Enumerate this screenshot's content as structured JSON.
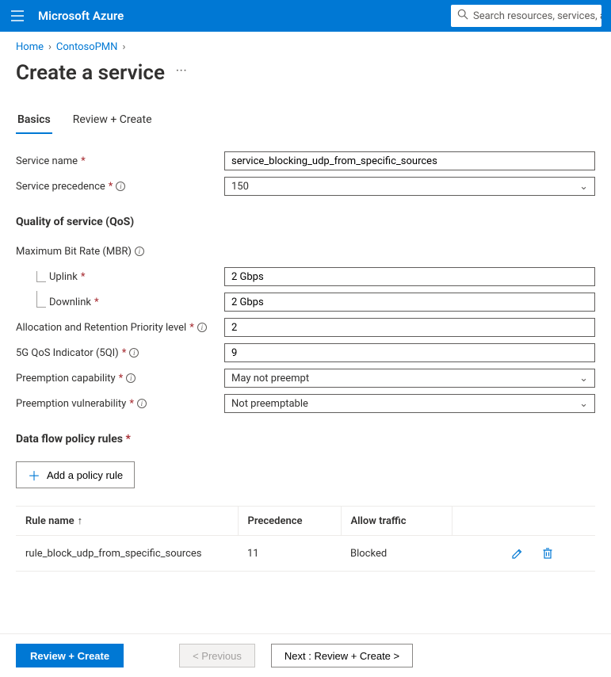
{
  "brand": "Microsoft Azure",
  "search": {
    "placeholder": "Search resources, services, and"
  },
  "breadcrumb": {
    "home": "Home",
    "item1": "ContosoPMN"
  },
  "page_title": "Create a service",
  "tabs": {
    "basics": "Basics",
    "review": "Review + Create"
  },
  "labels": {
    "service_name": "Service name",
    "service_precedence": "Service precedence",
    "qos_title": "Quality of service (QoS)",
    "mbr": "Maximum Bit Rate (MBR)",
    "uplink": "Uplink",
    "downlink": "Downlink",
    "arp": "Allocation and Retention Priority level",
    "qi": "5G QoS Indicator (5QI)",
    "preempt_cap": "Preemption capability",
    "preempt_vuln": "Preemption vulnerability",
    "rules_title": "Data flow policy rules",
    "add_rule": "Add a policy rule"
  },
  "values": {
    "service_name": "service_blocking_udp_from_specific_sources",
    "service_precedence": "150",
    "uplink": "2 Gbps",
    "downlink": "2 Gbps",
    "arp": "2",
    "qi": "9",
    "preempt_cap": "May not preempt",
    "preempt_vuln": "Not preemptable"
  },
  "rules_table": {
    "headers": {
      "name": "Rule name",
      "precedence": "Precedence",
      "allow": "Allow traffic"
    },
    "rows": [
      {
        "name": "rule_block_udp_from_specific_sources",
        "precedence": "11",
        "allow": "Blocked"
      }
    ]
  },
  "footer": {
    "review": "Review + Create",
    "previous": "< Previous",
    "next": "Next : Review + Create >"
  }
}
